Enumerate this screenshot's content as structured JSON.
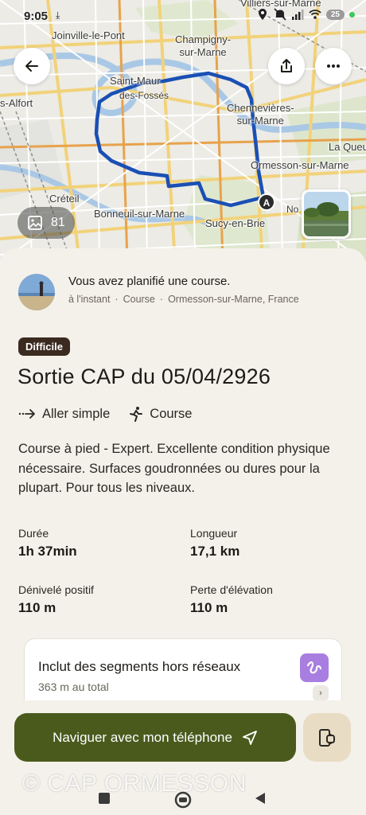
{
  "status_bar": {
    "time": "9:05",
    "battery": "25"
  },
  "map": {
    "labels": {
      "villiers": "Villiers-sur-Marne",
      "joinville": "Joinville-le-Pont",
      "champigny": "Champigny-\nsur-Marne",
      "saint_maur": "Saint-Maur",
      "fosses": "des-Fossés",
      "alfort": "s-Alfort",
      "chennevieres": "Chennevières-\nsur-Marne",
      "la_queue": "La Queu",
      "ormesson": "Ormesson-sur-Marne",
      "creteil": "Créteil",
      "bonneuil": "Bonneuil-sur-Marne",
      "sucy": "Sucy-en-Brie",
      "no": "No"
    },
    "start_marker": "A",
    "photo_count": "81"
  },
  "activity": {
    "planned_text": "Vous avez planifié une course.",
    "time": "à l'instant",
    "type": "Course",
    "location": "Ormesson-sur-Marne, France"
  },
  "route": {
    "difficulty": "Difficile",
    "title": "Sortie CAP du 05/04/2926",
    "direction": "Aller simple",
    "sport": "Course",
    "description": "Course à pied - Expert. Excellente condition physique nécessaire. Surfaces goudronnées ou dures pour la plupart. Pour tous les niveaux."
  },
  "stats": {
    "duration_label": "Durée",
    "duration_value": "1h 37min",
    "length_label": "Longueur",
    "length_value": "17,1 km",
    "gain_label": "Dénivelé positif",
    "gain_value": "110 m",
    "loss_label": "Perte d'élévation",
    "loss_value": "110 m"
  },
  "offroad": {
    "title": "Inclut des segments hors réseaux",
    "subtitle": "363 m au total"
  },
  "actions": {
    "navigate_label": "Naviguer avec mon téléphone"
  },
  "watermark": "© CAP ORMESSON",
  "colors": {
    "accent": "#4a5a1d",
    "route": "#1a4fb4",
    "badge": "#3b2a20",
    "offroad_icon": "#a87ee0"
  }
}
